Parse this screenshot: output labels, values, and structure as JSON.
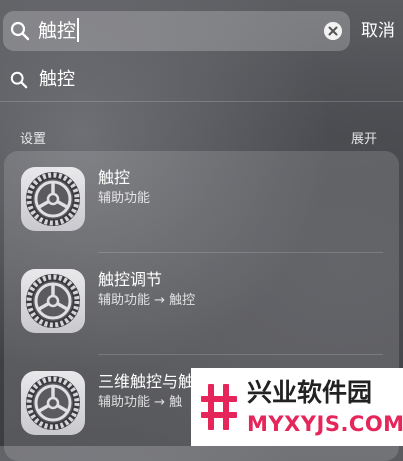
{
  "search": {
    "query": "触控",
    "cancel_label": "取消"
  },
  "suggestion": {
    "text": "触控"
  },
  "section": {
    "title": "设置",
    "action_label": "展开"
  },
  "results": [
    {
      "title": "触控",
      "subtitle": "辅助功能",
      "icon": "settings-gear-icon"
    },
    {
      "title": "触控调节",
      "subtitle": "辅助功能 → 触控",
      "icon": "settings-gear-icon"
    },
    {
      "title": "三维触控与触",
      "subtitle": "辅助功能 → 触",
      "icon": "settings-gear-icon"
    }
  ],
  "watermark": {
    "title": "兴业软件园",
    "url": "MYXYJS.COM"
  },
  "colors": {
    "watermark_accent": "#e6265b"
  }
}
